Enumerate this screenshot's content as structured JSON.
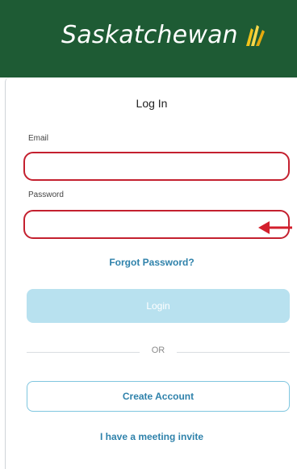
{
  "header": {
    "brand_text": "Saskatchewan",
    "brand_color": "#1e5b34",
    "logo_icon": "wheat-icon"
  },
  "login": {
    "title": "Log In",
    "email_label": "Email",
    "email_value": "",
    "password_label": "Password",
    "password_value": "",
    "forgot_password": "Forgot Password?",
    "login_button": "Login",
    "or_text": "OR",
    "create_account": "Create Account",
    "meeting_invite": "I have a meeting invite"
  },
  "colors": {
    "error_border": "#c4202f",
    "link": "#2f82ab",
    "disabled_button": "#b8e1ef",
    "annotation_arrow": "#d31f2c"
  },
  "annotation": {
    "icon": "red-arrow-icon"
  }
}
